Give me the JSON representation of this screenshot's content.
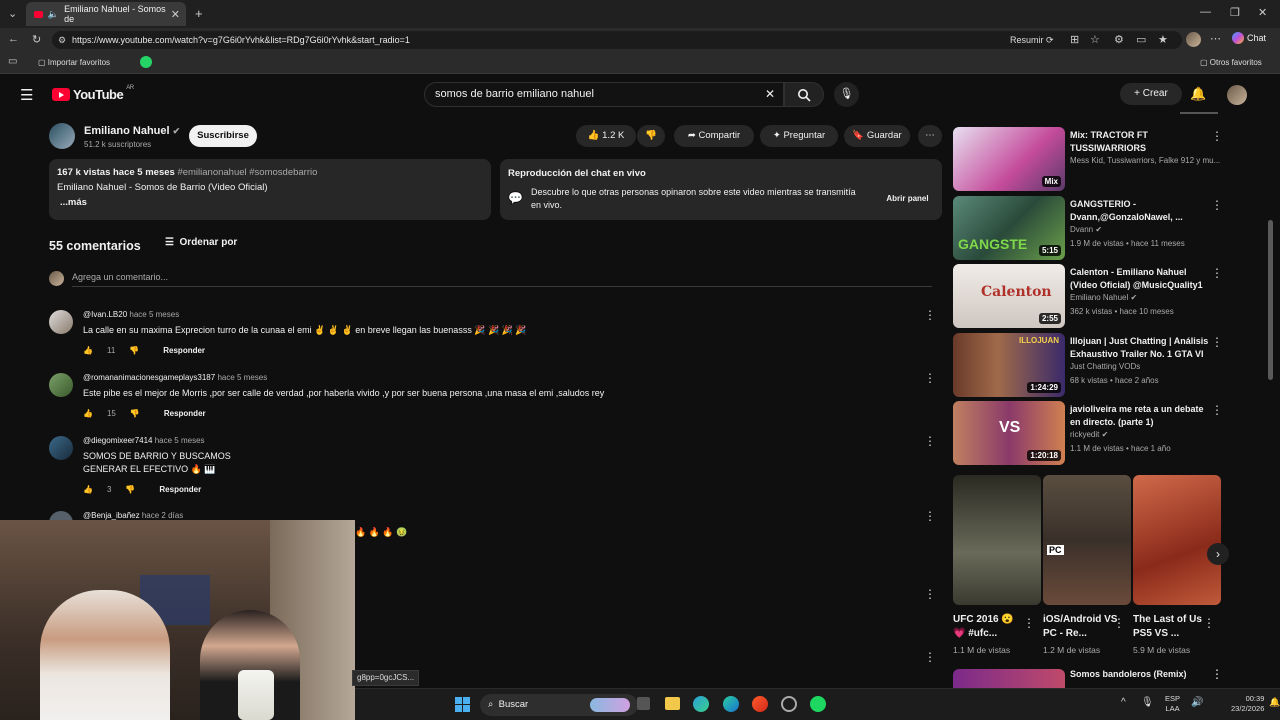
{
  "browser": {
    "tab_title": "Emiliano Nahuel - Somos de",
    "url": "https://www.youtube.com/watch?v=g7G6i0rYvhk&list=RDg7G6i0rYvhk&start_radio=1",
    "resume_label": "Resumir",
    "chat_label": "Chat",
    "favorites": [
      "Importar favoritos"
    ],
    "other_favorites": "Otros favoritos"
  },
  "youtube": {
    "logo_text": "YouTube",
    "region": "AR",
    "search_value": "somos de barrio emiliano nahuel",
    "create_label": "Crear"
  },
  "channel": {
    "name": "Emiliano Nahuel",
    "subscribers": "51.2 k suscriptores",
    "subscribe_label": "Suscribirse",
    "likes": "1.2 K",
    "share_label": "Compartir",
    "ask_label": "Preguntar",
    "save_label": "Guardar"
  },
  "description": {
    "views": "167 k vistas",
    "age": "hace 5 meses",
    "hashtags": "#emilianonahuel #somosdebarrio",
    "title": "Emiliano Nahuel - Somos de Barrio (Video Oficial)",
    "more": "...más"
  },
  "chat_replay": {
    "title": "Reproducción del chat en vivo",
    "text_line1": "Descubre lo que otras personas opinaron sobre este video mientras se transmitía",
    "text_line2": "en vivo.",
    "button": "Abrir panel"
  },
  "comments": {
    "count_label": "55 comentarios",
    "sort_label": "Ordenar por",
    "add_placeholder": "Agrega un comentario...",
    "reply_label": "Responder",
    "items": [
      {
        "author": "@Ivan.LB20",
        "time": "hace 5 meses",
        "lines": [
          "La calle en su maxima Exprecion turro de la cunaa el emi ✌️ ✌️ ✌️ en breve llegan las buenasss 🎉 🎉 🎉 🎉"
        ],
        "likes": "11"
      },
      {
        "author": "@romananimacionesgameplays3187",
        "time": "hace 5 meses",
        "lines": [
          "Este pibe es el mejor de Morris ,por ser calle de verdad ,por haberla vivido ,y por ser buena persona ,una masa el emi ,saludos rey"
        ],
        "likes": "15"
      },
      {
        "author": "@diegomixeer7414",
        "time": "hace 5 meses",
        "lines": [
          "SOMOS DE BARRIO Y BUSCAMOS",
          "GENERAR EL EFECTIVO 🔥 🎹"
        ],
        "likes": "3"
      },
      {
        "author": "@Benja_ibañez",
        "time": "hace 2 días",
        "lines": [
          "🔥 🔥 🔥 🤢"
        ],
        "likes": ""
      }
    ]
  },
  "status_link": "g8pp=0gcJCS...",
  "sidebar": {
    "items": [
      {
        "title": "Mix: TRACTOR FT TUSSIWARRIORS",
        "channel": "Mess Kid, Tussiwarriors, Falke 912 y mu...",
        "meta": "",
        "badge": "Mix",
        "thumb_color": "#c44b9b"
      },
      {
        "title": "GANGSTERIO - Dvann,@GonzaloNawel, ...",
        "channel": "Dvann",
        "meta": "1.9 M de vistas • hace 11 meses",
        "badge": "5:15",
        "thumb_color": "#3f7a6a"
      },
      {
        "title": "Calenton - Emiliano Nahuel (Video Oficial) @MusicQuality1",
        "channel": "Emiliano Nahuel",
        "meta": "362 k vistas • hace 10 meses",
        "badge": "2:55",
        "thumb_color": "#d9d4cf"
      },
      {
        "title": "Illojuan | Just Chatting | Análisis Exhaustivo Trailer No. 1 GTA VI",
        "channel": "Just Chatting VODs",
        "meta": "68 k vistas • hace 2 años",
        "badge": "1:24:29",
        "thumb_color": "#7a2c8a"
      },
      {
        "title": "javioliveira me reta a un debate en directo. (parte 1)",
        "channel": "rickyedit",
        "meta": "1.1 M de vistas • hace 1 año",
        "badge": "1:20:18",
        "thumb_color": "#b0432f"
      }
    ],
    "shorts": [
      {
        "title": "UFC 2016 😮 💗 #ufc...",
        "views": "1.1 M de vistas",
        "thumb_color": "#3b3a33"
      },
      {
        "title": "iOS/Android VS PC - Re...",
        "views": "1.2 M de vistas",
        "thumb_color": "#4e4a3f"
      },
      {
        "title": "The Last of Us PS5 VS ...",
        "views": "5.9 M de vistas",
        "thumb_color": "#8a3a2c"
      }
    ],
    "last_item_title": "Somos bandoleros (Remix)"
  },
  "taskbar": {
    "search_label": "Buscar",
    "lang": "ESP",
    "lang2": "LAA",
    "time": "00:39",
    "date": "23/2/2026"
  },
  "colors": {
    "bg": "#0f0f0f",
    "surface": "#272727",
    "accent_red": "#ff0033",
    "muted_text": "#aaaaaa"
  }
}
